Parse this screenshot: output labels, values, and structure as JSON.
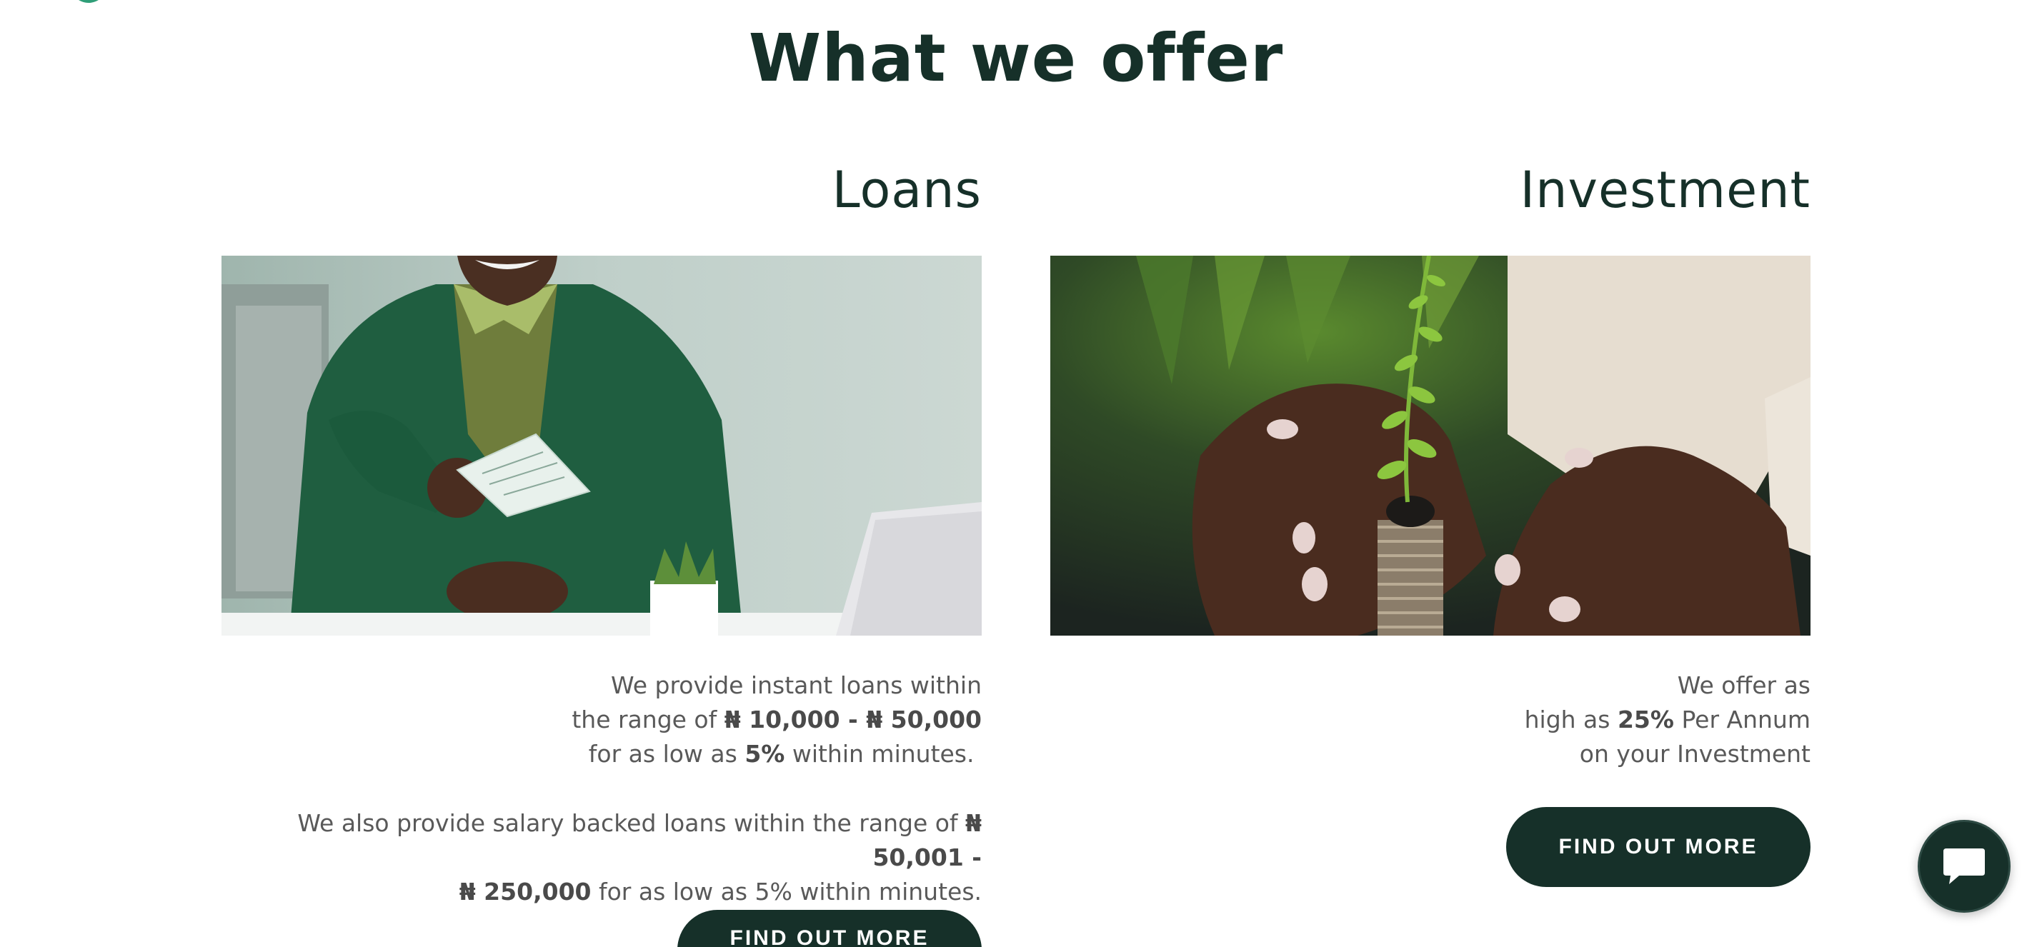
{
  "section": {
    "title": "What we offer"
  },
  "loans": {
    "title": "Loans",
    "line1": "We provide instant loans within",
    "line2_prefix": "the range of ",
    "line2_min": "₦ 10,000 - ",
    "line2_max": "₦ 50,000",
    "line3_prefix": "for as low as ",
    "line3_rate": "5%",
    "line3_suffix": " within minutes.",
    "salary_prefix": "We also provide salary backed loans within the range of ",
    "salary_min": "₦ 50,001 -",
    "salary_max": "₦ 250,000",
    "salary_suffix": " for as low as 5% within minutes.",
    "button_label": "FIND OUT MORE",
    "image_icon": "businessman-handing-cheque-image"
  },
  "investment": {
    "title": "Investment",
    "line1": "We offer as",
    "line2_prefix": "high as ",
    "line2_rate": "25%",
    "line2_suffix": " Per Annum",
    "line3": "on your Investment",
    "button_label": "FIND OUT MORE",
    "image_icon": "hands-protecting-plant-on-coins-image"
  },
  "chat": {
    "icon": "chat-bubble-icon"
  },
  "colors": {
    "brand_dark": "#163029",
    "text_grey": "#595959",
    "accent_green": "#2f9e78",
    "background": "#ffffff"
  }
}
